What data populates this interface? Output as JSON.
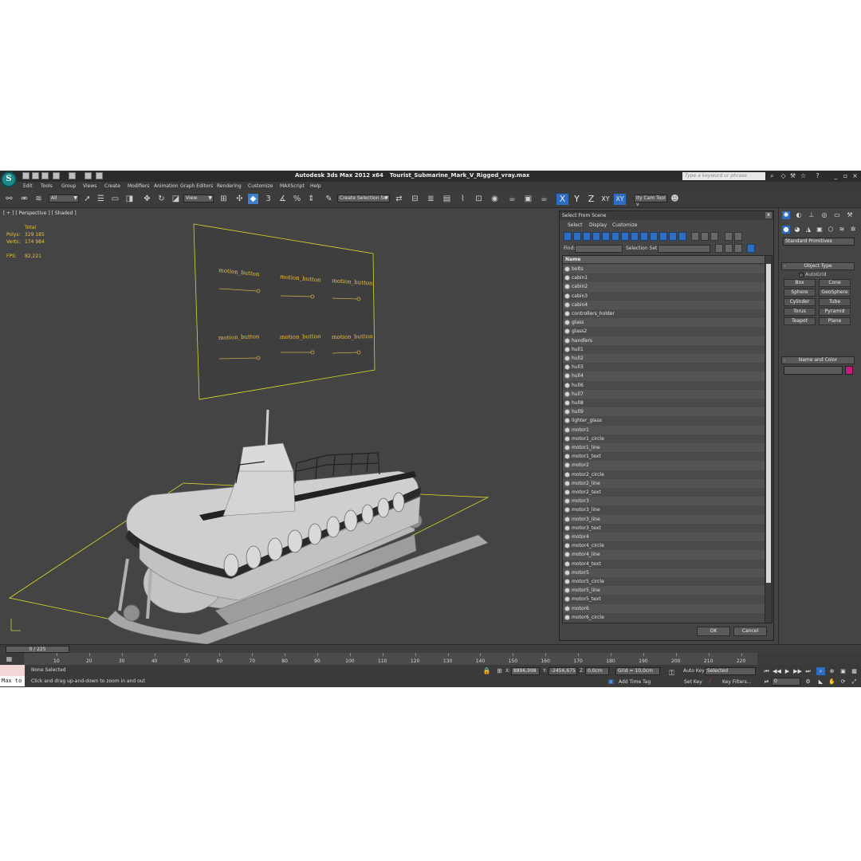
{
  "app": {
    "logo_glyph": "S",
    "title": "Autodesk 3ds Max  2012 x64",
    "filename": "Tourist_Submarine_Mark_V_Rigged_vray.max",
    "search_placeholder": "Type a keyword or phrase"
  },
  "menu": [
    "Edit",
    "Tools",
    "Group",
    "Views",
    "Create",
    "Modifiers",
    "Animation",
    "Graph Editors",
    "Rendering",
    "Customize",
    "MAXScript",
    "Help"
  ],
  "toolbar": {
    "selection_filter": "All",
    "ref_coord": "View",
    "named_selection": "Create Selection Se",
    "axis_x": "X",
    "axis_y": "Y",
    "axis_z": "Z",
    "axis_xy": "XY",
    "axis_xy2": "XY",
    "tool_label": "ity Cam Tool v"
  },
  "viewport": {
    "label": "[ + ] [ Perspective ] [ Shaded ]",
    "stats": {
      "total_label": "Total",
      "polys_label": "Polys:",
      "polys": "329 185",
      "verts_label": "Verts:",
      "verts": "174 984",
      "fps_label": "FPS:",
      "fps": "82,221"
    },
    "controller_labels": [
      "motion_button",
      "motion_button",
      "motion_button",
      "motion_button",
      "motion_button",
      "motion_button"
    ]
  },
  "dialog": {
    "title": "Select From Scene",
    "close_glyph": "x",
    "menu": [
      "Select",
      "Display",
      "Customize"
    ],
    "find_label": "Find:",
    "selection_set_label": "Selection Set:",
    "column_name": "Name",
    "items": [
      "bolts",
      "cabin1",
      "cabin2",
      "cabin3",
      "cabin4",
      "controllers_holder",
      "glass",
      "glass2",
      "handlers",
      "hull1",
      "hull2",
      "hull3",
      "hull4",
      "hull6",
      "hull7",
      "hull8",
      "hull9",
      "lighter_glass",
      "motor1",
      "motor1_circle",
      "motor1_line",
      "motor1_text",
      "motor2",
      "motor2_circle",
      "motor2_line",
      "motor2_text",
      "motor3",
      "motor3_line",
      "motor3_line",
      "motor3_text",
      "motor4",
      "motor4_circle",
      "motor4_line",
      "motor4_text",
      "motor5",
      "motor5_circle",
      "motor5_line",
      "motor5_text",
      "motor6",
      "motor6_circle"
    ],
    "ok_label": "OK",
    "cancel_label": "Cancel"
  },
  "command_panel": {
    "category": "Standard Primitives",
    "object_type_label": "Object Type",
    "autogrid_label": "AutoGrid",
    "primitives": [
      "Box",
      "Cone",
      "Sphere",
      "GeoSphere",
      "Cylinder",
      "Tube",
      "Torus",
      "Pyramid",
      "Teapot",
      "Plane"
    ],
    "name_color_label": "Name and Color",
    "object_color": "#c5197d"
  },
  "timeline": {
    "frame_display": "0 / 225",
    "ticks": [
      "10",
      "20",
      "30",
      "40",
      "50",
      "60",
      "70",
      "80",
      "90",
      "100",
      "110",
      "120",
      "130",
      "140",
      "150",
      "160",
      "170",
      "180",
      "190",
      "200",
      "210",
      "220"
    ]
  },
  "status": {
    "maxscript_listener": "Max to",
    "selection": "None Selected",
    "prompt": "Click and drag up-and-down to zoom in and out",
    "x_label": "X:",
    "x_value": "8896,998",
    "y_label": "Y:",
    "y_value": "-2456,675",
    "z_label": "Z:",
    "z_value": "0,0cm",
    "grid": "Grid = 10,0cm",
    "auto_key": "Auto Key",
    "key_mode": "Selected",
    "set_key": "Set Key",
    "key_filters": "Key Filters...",
    "add_time_tag": "Add Time Tag",
    "current_frame": "0"
  },
  "colors": {
    "accent": "#2e6ec0",
    "viewport_bg": "#444444",
    "stats_text": "#e8c23a",
    "selection_wire": "#d9d92a"
  }
}
